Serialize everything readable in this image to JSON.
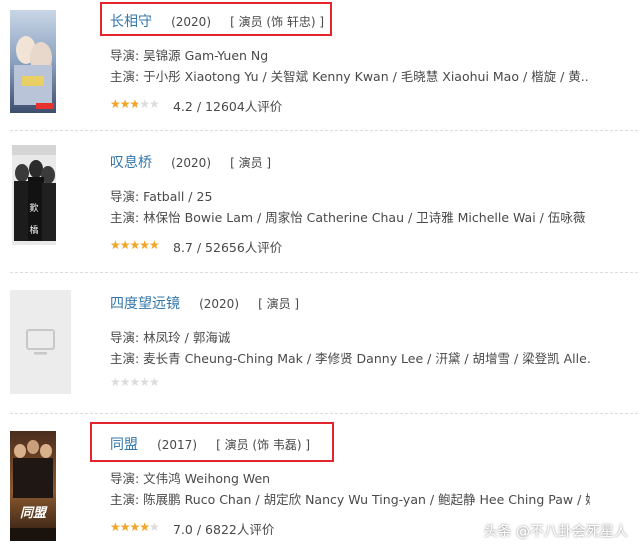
{
  "items": [
    {
      "title": "长相守",
      "year": "(2020)",
      "role": "[ 演员 (饰 轩忠) ]",
      "director": "导演: 吴锦源 Gam-Yuen Ng",
      "cast": "主演: 于小彤 Xiaotong Yu / 关智斌 Kenny Kwan / 毛晓慧 Xiaohui Mao / 楷旋 / 黄...",
      "rating_text": "4.2 / 12604人评价",
      "stars_fraction": 0.5,
      "poster": "drama-poster-1"
    },
    {
      "title": "叹息桥",
      "year": "(2020)",
      "role": "[ 演员 ]",
      "director": "导演: Fatball / 25",
      "cast": "主演: 林保怡 Bowie Lam / 周家怡 Catherine Chau / 卫诗雅 Michelle Wai / 伍咏薇 ...",
      "rating_text": "8.7 / 52656人评价",
      "stars_fraction": 0.9,
      "poster": "drama-poster-2"
    },
    {
      "title": "四度望远镜",
      "year": "(2020)",
      "role": "[ 演员 ]",
      "director": "导演: 林凤玲 / 郭海诚",
      "cast": "主演: 麦长青 Cheung-Ching Mak / 李修贤 Danny Lee / 汧黛 / 胡增雪 / 梁登凯 Alle...",
      "rating_text": "",
      "stars_fraction": 0,
      "poster": "placeholder-tv-icon"
    },
    {
      "title": "同盟",
      "year": "(2017)",
      "role": "[ 演员 (饰 韦磊) ]",
      "director": "导演: 文伟鸿 Weihong Wen",
      "cast": "主演: 陈展鹏 Ruco Chan / 胡定欣 Nancy Wu Ting-yan / 鲍起静 Hee Ching Paw / 姚...",
      "rating_text": "7.0 / 6822人评价",
      "stars_fraction": 0.7,
      "poster": "drama-poster-3"
    }
  ],
  "watermark": "头条 @不八卦会死星人",
  "colors": {
    "link": "#3377aa",
    "star": "#f3a526",
    "highlight": "#e3262b"
  }
}
